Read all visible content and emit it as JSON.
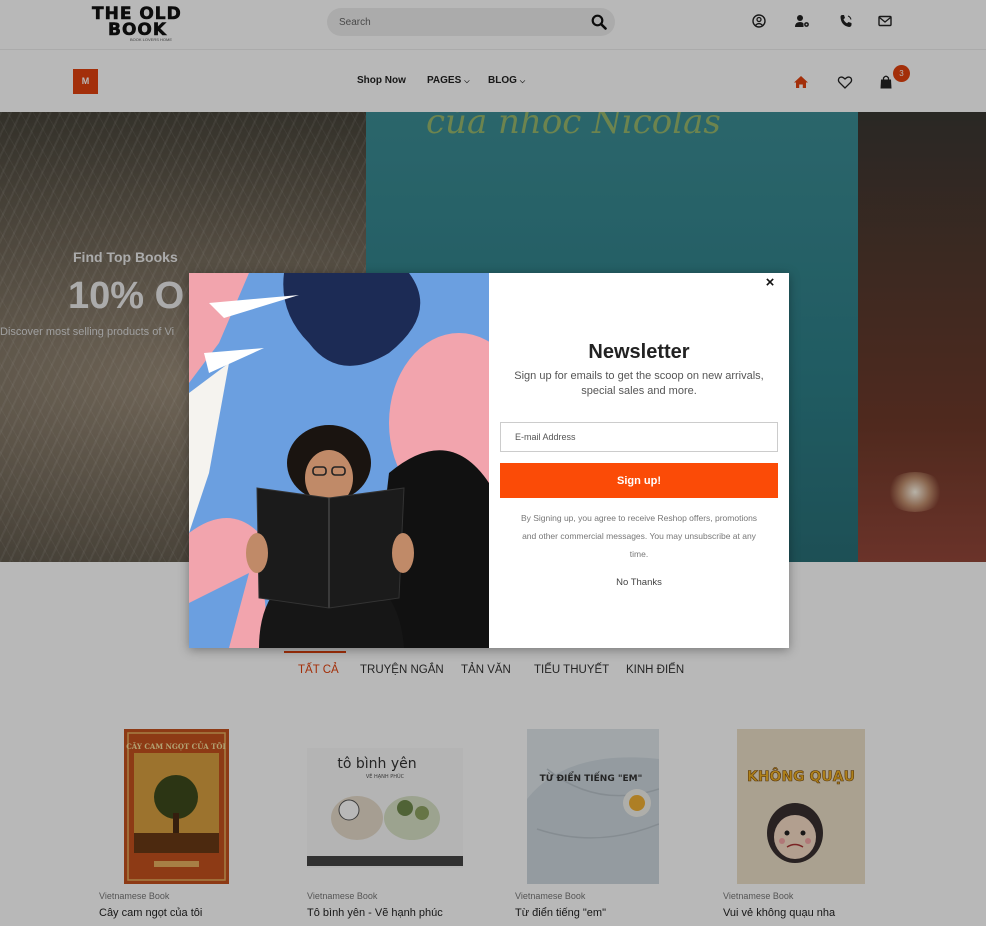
{
  "logo": {
    "line1": "THE OLD",
    "line2": "BOOK",
    "tagline": "BOOK LOVERS HOME"
  },
  "search": {
    "placeholder": "Search"
  },
  "header_icons": [
    "user-circle-icon",
    "user-gear-icon",
    "phone-icon",
    "envelope-icon"
  ],
  "nav": {
    "menu_button": "M",
    "items": [
      {
        "label": "Shop Now",
        "has_caret": false
      },
      {
        "label": "PAGES",
        "has_caret": true
      },
      {
        "label": "BLOG",
        "has_caret": true
      }
    ],
    "cart_count": "3"
  },
  "hero": {
    "book_title": "của nhóc Nicolas",
    "kicker": "Find Top Books",
    "headline": "10% O",
    "subline": "Discover most selling products of Vi"
  },
  "tabs": [
    {
      "label": "TẤT CẢ",
      "active": true
    },
    {
      "label": "TRUYỆN NGẮN",
      "active": false
    },
    {
      "label": "TẢN VĂN",
      "active": false
    },
    {
      "label": "TIỂU THUYẾT",
      "active": false
    },
    {
      "label": "KINH ĐIỂN",
      "active": false
    }
  ],
  "products": [
    {
      "category": "Vietnamese Book",
      "name": "Cây cam ngọt của tôi",
      "cover_title": "CÂY CAM NGỌT CỦA TÔI"
    },
    {
      "category": "Vietnamese Book",
      "name": "Tô bình yên - Vẽ hạnh phúc",
      "cover_title": "tô bình yên",
      "cover_subtitle": "VẼ HẠNH PHÚC"
    },
    {
      "category": "Vietnamese Book",
      "name": "Từ điển tiếng \"em\"",
      "cover_title": "TỪ ĐIỂN TIẾNG \"EM\""
    },
    {
      "category": "Vietnamese Book",
      "name": "Vui vẻ không quạu nha",
      "cover_title": "KHÔNG QUẠU"
    }
  ],
  "newsletter": {
    "title": "Newsletter",
    "text": "Sign up for emails to get the scoop on new arrivals, special sales and more.",
    "email_placeholder": "E-mail Address",
    "button": "Sign up!",
    "legal": "By Signing up, you agree to receive Reshop offers, promotions and other commercial messages. You may unsubscribe at any time.",
    "dismiss": "No Thanks",
    "close": "×"
  },
  "colors": {
    "accent": "#e2420e",
    "button": "#fb4b07"
  }
}
